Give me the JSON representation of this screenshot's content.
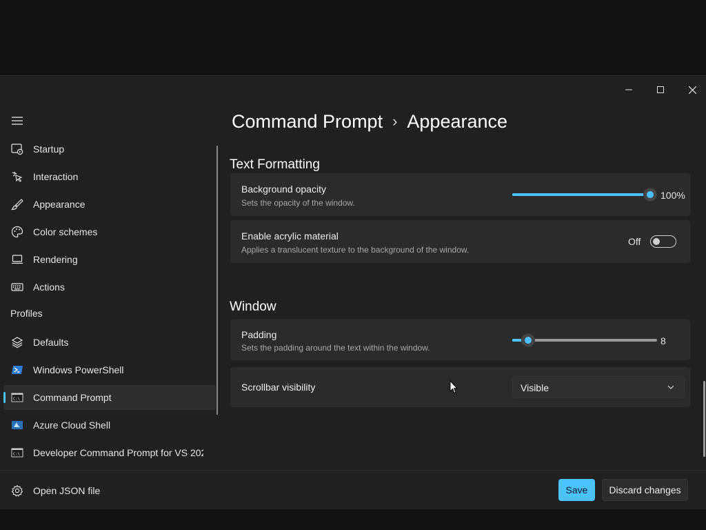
{
  "window": {
    "controls": [
      "minimize-icon",
      "maximize-icon",
      "close-icon"
    ]
  },
  "breadcrumb": {
    "parent": "Command Prompt",
    "separator": "›",
    "current": "Appearance"
  },
  "nav": {
    "items": [
      {
        "label": "Startup",
        "icon": "startup-icon"
      },
      {
        "label": "Interaction",
        "icon": "interaction-icon"
      },
      {
        "label": "Appearance",
        "icon": "brush-icon"
      },
      {
        "label": "Color schemes",
        "icon": "palette-icon"
      },
      {
        "label": "Rendering",
        "icon": "monitor-icon"
      },
      {
        "label": "Actions",
        "icon": "keyboard-icon"
      }
    ],
    "profiles_header": "Profiles",
    "profiles": [
      {
        "label": "Defaults",
        "icon": "layers-icon"
      },
      {
        "label": "Windows PowerShell",
        "icon": "powershell-icon"
      },
      {
        "label": "Command Prompt",
        "icon": "cmd-icon",
        "selected": true
      },
      {
        "label": "Azure Cloud Shell",
        "icon": "azure-icon"
      },
      {
        "label": "Developer Command Prompt for VS 202",
        "icon": "cmd-icon"
      }
    ],
    "open_json": "Open JSON file"
  },
  "content": {
    "text_formatting_title": "Text Formatting",
    "background_opacity": {
      "title": "Background opacity",
      "desc": "Sets the opacity of the window.",
      "value": 100,
      "value_label": "100%"
    },
    "acrylic": {
      "title": "Enable acrylic material",
      "desc": "Applies a translucent texture to the background of the window.",
      "state_label": "Off",
      "on": false
    },
    "window_title": "Window",
    "padding": {
      "title": "Padding",
      "desc": "Sets the padding around the text within the window.",
      "value": 8,
      "value_label": "8",
      "fraction": 0.11
    },
    "scrollbar": {
      "title": "Scrollbar visibility",
      "selected": "Visible"
    }
  },
  "footer": {
    "save": "Save",
    "discard": "Discard changes"
  },
  "colors": {
    "accent": "#4cc2ff",
    "background": "#202020",
    "card": "#2b2b2b"
  }
}
